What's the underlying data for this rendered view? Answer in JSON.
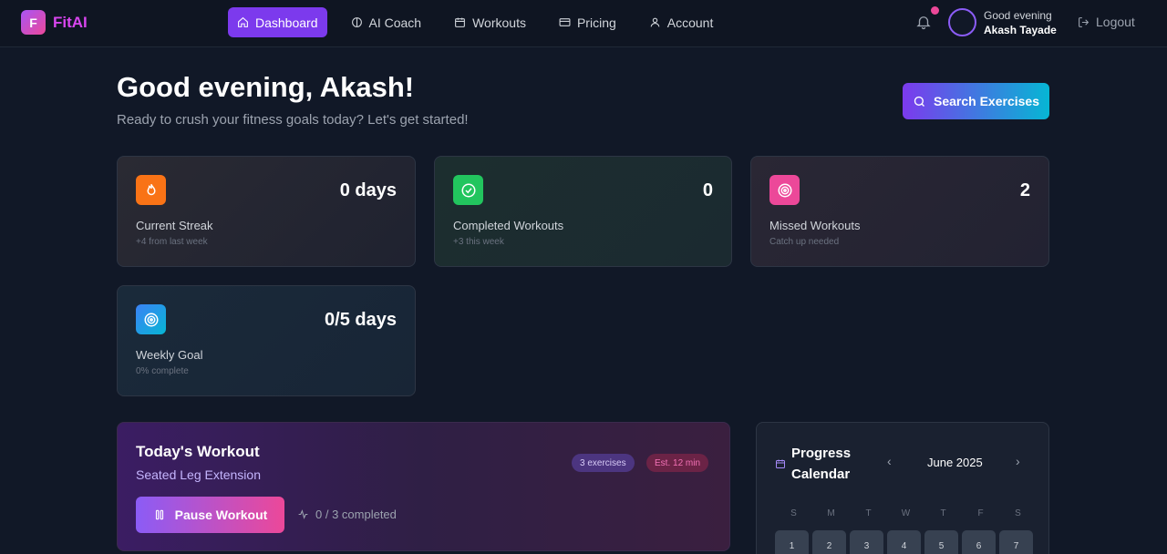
{
  "app": {
    "logo_letter": "F",
    "name": "FitAI"
  },
  "nav": {
    "items": [
      {
        "label": "Dashboard",
        "icon": "home-icon"
      },
      {
        "label": "AI Coach",
        "icon": "brain-icon"
      },
      {
        "label": "Workouts",
        "icon": "calendar-icon"
      },
      {
        "label": "Pricing",
        "icon": "credit-card-icon"
      },
      {
        "label": "Account",
        "icon": "user-icon"
      }
    ],
    "active": "Dashboard"
  },
  "user": {
    "greeting": "Good evening",
    "name": "Akash Tayade",
    "logout_label": "Logout"
  },
  "hero": {
    "title": "Good evening, Akash!",
    "subtitle": "Ready to crush your fitness goals today? Let's get started!",
    "search_label": "Search Exercises"
  },
  "stats": [
    {
      "value": "0 days",
      "label": "Current Streak",
      "note": "+4 from last week",
      "icon": "flame-icon",
      "color": "#f97316"
    },
    {
      "value": "0",
      "label": "Completed Workouts",
      "note": "+3 this week",
      "icon": "check-circle-icon",
      "color": "#22c55e"
    },
    {
      "value": "2",
      "label": "Missed Workouts",
      "note": "Catch up needed",
      "icon": "target-icon",
      "color": "#ec4899"
    },
    {
      "value": "0/5 days",
      "label": "Weekly Goal",
      "note": "0% complete",
      "icon": "target-icon",
      "color": "#3b82f6"
    }
  ],
  "workout": {
    "title": "Today's Workout",
    "exercise": "Seated Leg Extension",
    "exercises_pill": "3 exercises",
    "time_pill": "Est. 12 min",
    "pause_label": "Pause Workout",
    "progress": "0 / 3 completed"
  },
  "calendar": {
    "title": "Progress Calendar",
    "month": "June 2025",
    "prev": "‹",
    "next": "›",
    "weekdays": [
      "S",
      "M",
      "T",
      "W",
      "T",
      "F",
      "S"
    ],
    "days": [
      "1",
      "2",
      "3",
      "4",
      "5",
      "6",
      "7"
    ]
  }
}
